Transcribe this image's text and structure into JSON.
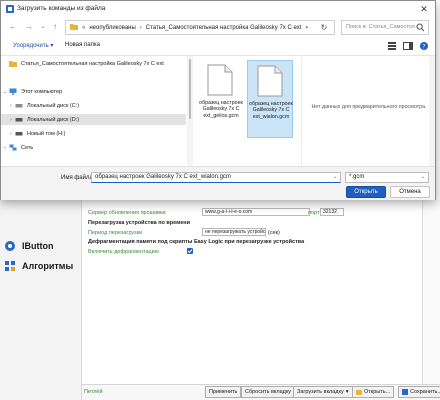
{
  "dialog": {
    "title": "Загрузить команды из файла",
    "close_label": "✕",
    "address": {
      "segments": [
        "неопубликованы",
        "Статья_Самостоятельная настройка Galileosky 7x C ext"
      ]
    },
    "search_placeholder": "Поиск в: Статья_Самостоя...",
    "toolbar": {
      "organize_label": "Упорядочить ▾",
      "new_folder_label": "Новая папка"
    },
    "nav_pane": {
      "items": [
        {
          "label": "Статья_Самостоятельная настройка Galileosky 7x C ext",
          "arrow": "",
          "icon": "folder-icon"
        },
        {
          "label": "Этот компьютер",
          "arrow": "⌄",
          "icon": "computer-icon"
        },
        {
          "label": "Локальный диск (C:)",
          "arrow": "›",
          "icon": "drive-icon"
        },
        {
          "label": "Локальный диск (D:)",
          "arrow": "›",
          "icon": "drive-icon"
        },
        {
          "label": "Новый том (H:)",
          "arrow": "›",
          "icon": "drive-icon"
        },
        {
          "label": "Сеть",
          "arrow": "›",
          "icon": "network-icon"
        }
      ]
    },
    "files": [
      {
        "name": "образец настроек Galileosky 7x C ext_gelios.gcm"
      },
      {
        "name": "образец настроек Galileosky 7x C ext_wialon.gcm"
      }
    ],
    "preview_text": "Нет данных для предварительного просмотра.",
    "footer": {
      "filename_label": "Имя файла:",
      "filename_value": "образец настроек Galileosky 7x C ext_wialon.gcm",
      "filter_value": "*.gcm",
      "open_label": "Открыть",
      "cancel_label": "Отмена"
    }
  },
  "app": {
    "nav": [
      {
        "label": "IButton"
      },
      {
        "label": "Алгоритмы"
      }
    ],
    "rows": {
      "server_update_label": "Сервер обновления прошивки",
      "server_update_value": "www.g-a-l-i-l-e-o.com",
      "port_label": "порт",
      "port_value": "32132",
      "reboot_section": "Перезагрузка устройства по времени",
      "reboot_period_label": "Период перезагрузки",
      "reboot_period_value": "не перезагружать устройство",
      "reboot_period_unit": "(сек)",
      "defrag_section": "Дефрагментация памяти под скрипты Easy Logic при перезагрузке устройства",
      "defrag_enable_label": "Включить дефрагментацию"
    },
    "bottom": {
      "status": "Петлёй",
      "apply": "Применить",
      "reset_tab": "Сбросить вкладку",
      "load_tab": "Загрузить вкладку",
      "open": "Открыть...",
      "save": "Сохранить..."
    }
  },
  "colors": {
    "accent": "#1f5fbf",
    "selection": "#cce4f7",
    "app_green": "#3a8d3a"
  }
}
